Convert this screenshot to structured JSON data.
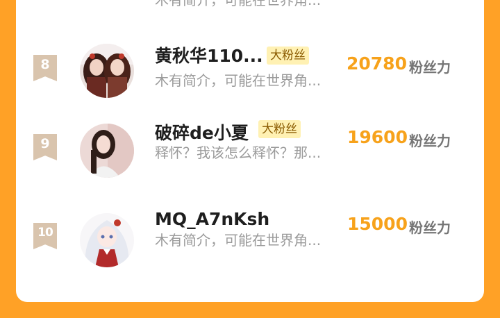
{
  "top_partial": {
    "bio": "木有简介，可能在世界角..."
  },
  "ranking": [
    {
      "rank": "8",
      "name": "黄秋华110...",
      "badge": "大粉丝",
      "bio": "木有简介，可能在世界角...",
      "score": "20780",
      "unit": "粉丝力",
      "avatar_icon": "two-girls-photo-avatar"
    },
    {
      "rank": "9",
      "name": "破碎de小夏",
      "badge": "大粉丝",
      "bio": "释怀？我该怎么释怀？那...",
      "score": "19600",
      "unit": "粉丝力",
      "avatar_icon": "girl-photo-avatar"
    },
    {
      "rank": "10",
      "name": "MQ_A7nKsh",
      "badge": "",
      "bio": "木有简介，可能在世界角...",
      "score": "15000",
      "unit": "粉丝力",
      "avatar_icon": "anime-girl-avatar"
    }
  ],
  "colors": {
    "background": "#ffa126",
    "score": "#f7a21b",
    "rank_badge": "#d9c4ad",
    "fan_badge_bg": "#fff1b3"
  }
}
